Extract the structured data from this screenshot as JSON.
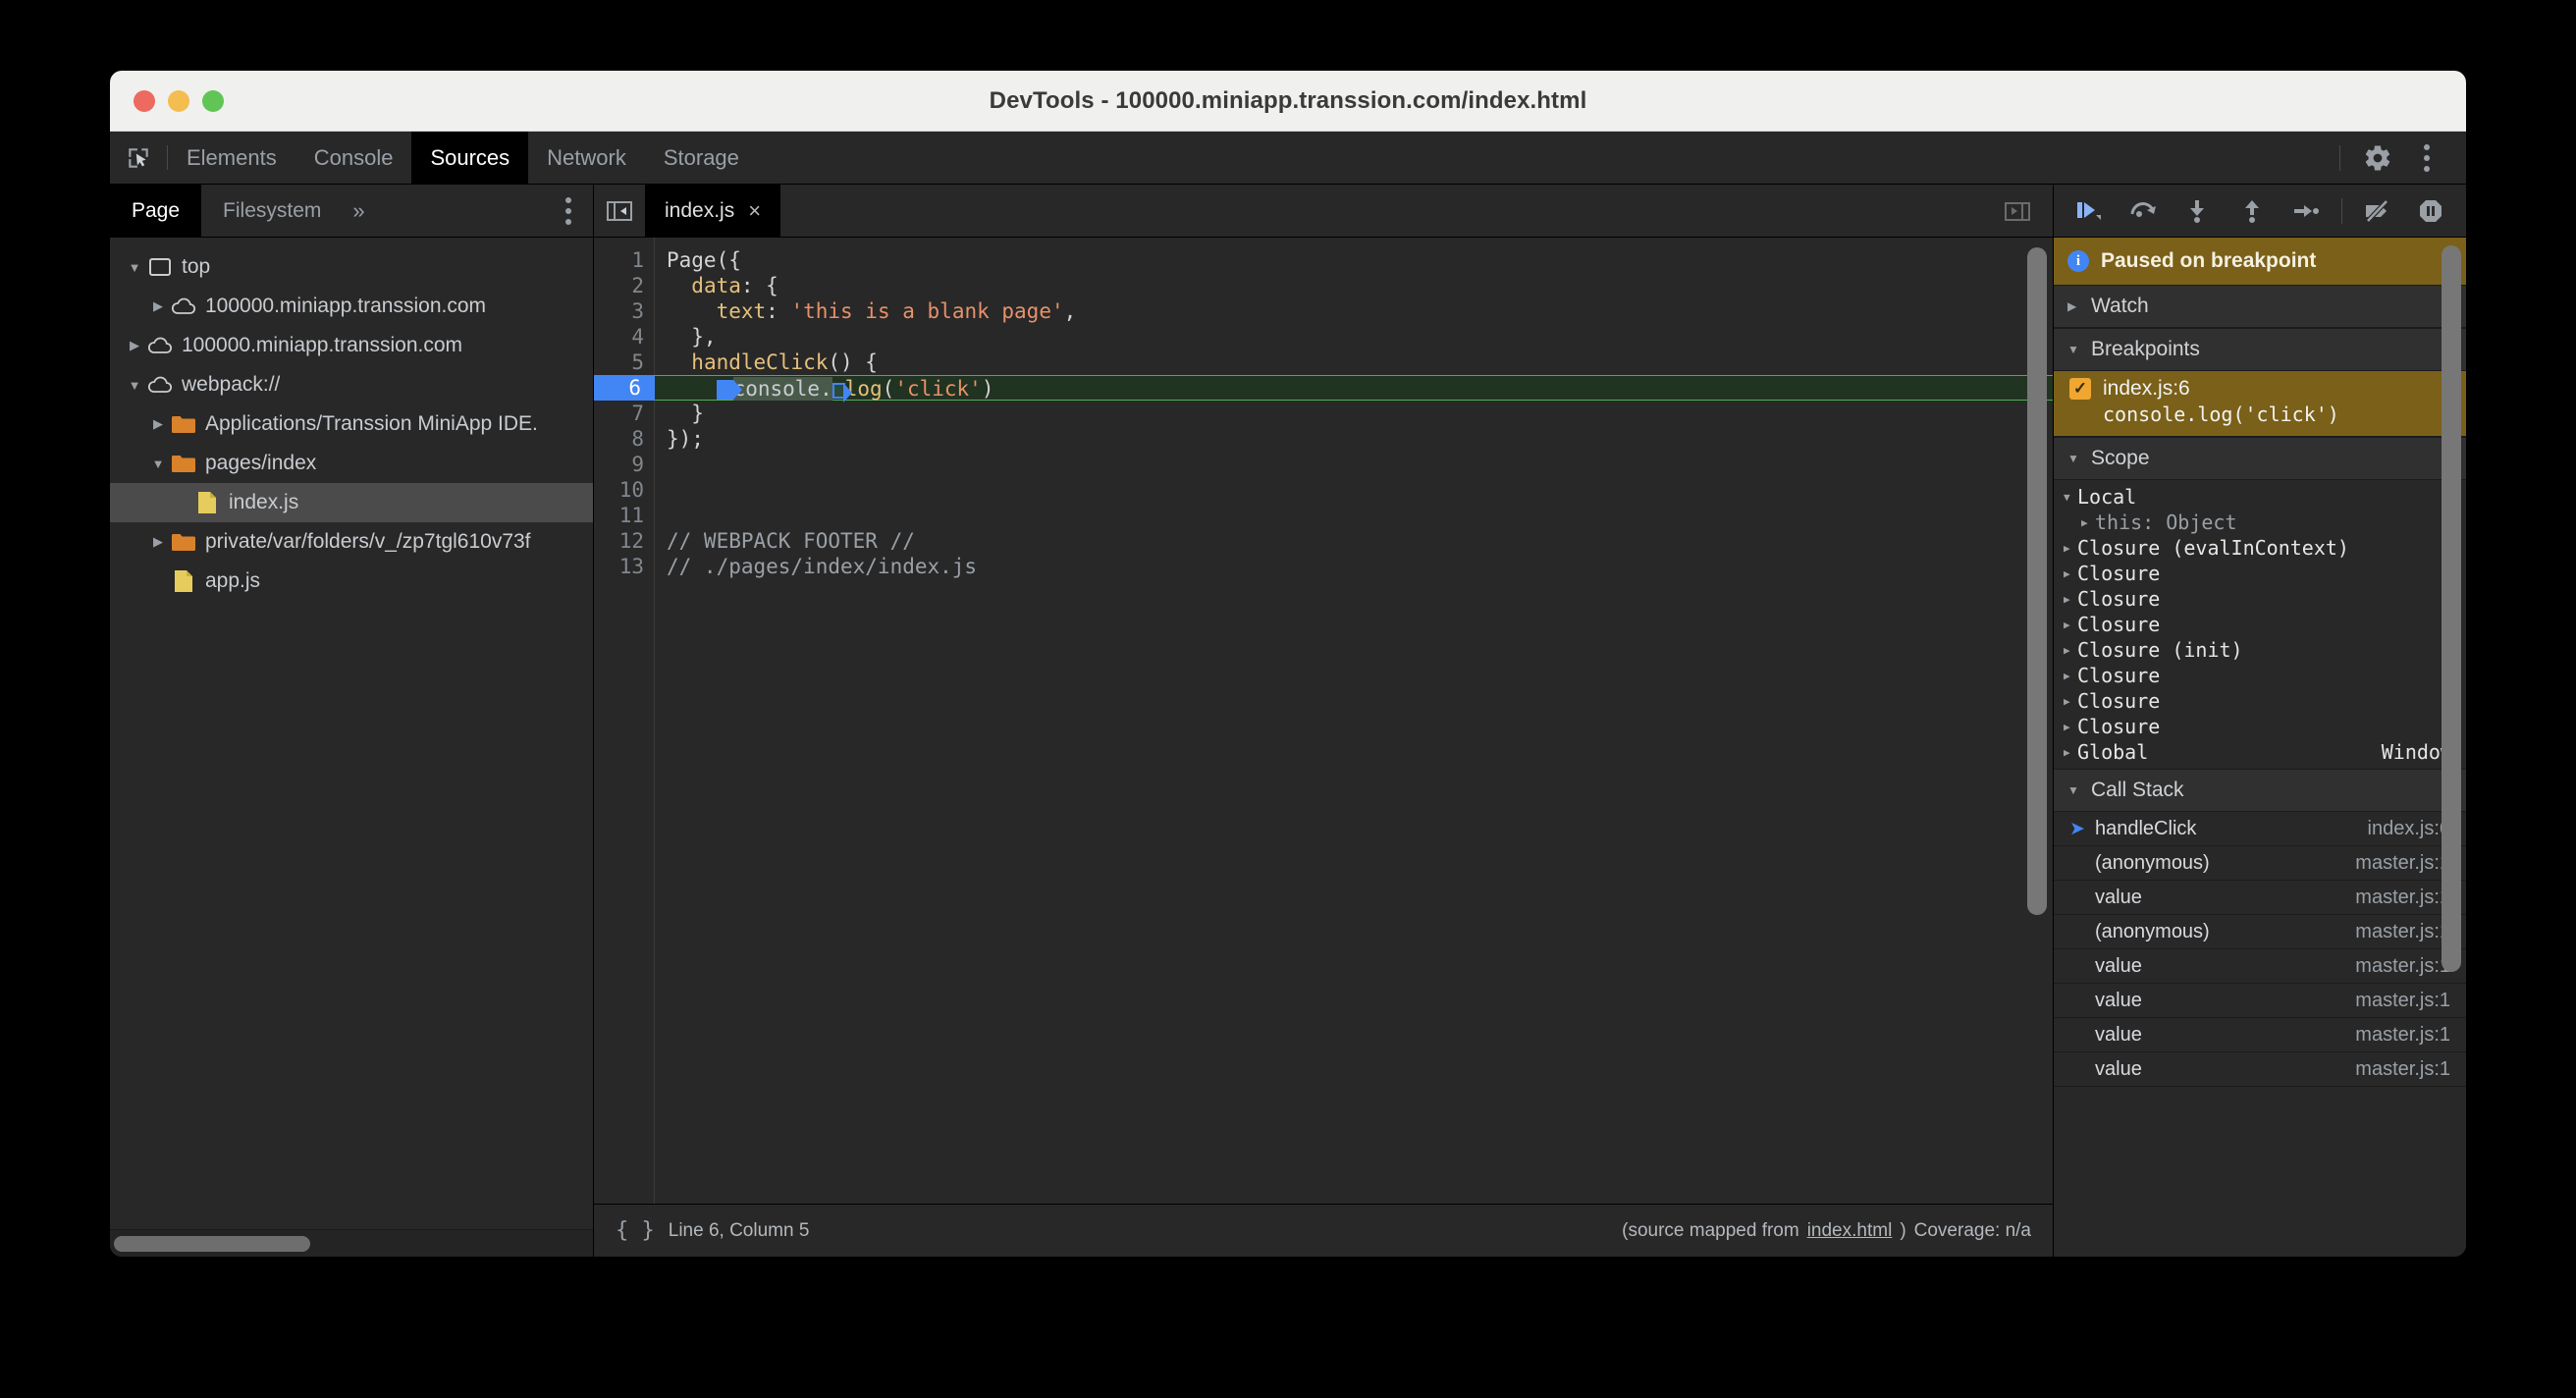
{
  "window": {
    "title": "DevTools - 100000.miniapp.transsion.com/index.html",
    "traffic_lights": [
      "close",
      "minimize",
      "zoom"
    ]
  },
  "devtools_tabs": {
    "inspect_icon": "inspect-cursor-icon",
    "items": [
      {
        "label": "Elements",
        "active": false
      },
      {
        "label": "Console",
        "active": false
      },
      {
        "label": "Sources",
        "active": true
      },
      {
        "label": "Network",
        "active": false
      },
      {
        "label": "Storage",
        "active": false
      }
    ],
    "settings_icon": "gear-icon",
    "menu_icon": "kebab-menu-icon"
  },
  "navigator": {
    "tabs": [
      {
        "label": "Page",
        "active": true
      },
      {
        "label": "Filesystem",
        "active": false
      }
    ],
    "overflow_label": "»",
    "menu_icon": "kebab-menu-icon",
    "tree": [
      {
        "label": "top",
        "icon": "frame-icon",
        "twisty": "▼",
        "depth": 0,
        "selected": false
      },
      {
        "label": "100000.miniapp.transsion.com",
        "icon": "cloud-icon",
        "twisty": "▶",
        "depth": 1,
        "selected": false
      },
      {
        "label": "100000.miniapp.transsion.com",
        "icon": "cloud-icon",
        "twisty": "▶",
        "depth": 0,
        "selected": false
      },
      {
        "label": "webpack://",
        "icon": "cloud-icon",
        "twisty": "▼",
        "depth": 0,
        "selected": false
      },
      {
        "label": "Applications/Transsion MiniApp IDE.",
        "icon": "folder-icon",
        "twisty": "▶",
        "depth": 1,
        "selected": false
      },
      {
        "label": "pages/index",
        "icon": "folder-icon",
        "twisty": "▼",
        "depth": 1,
        "selected": false
      },
      {
        "label": "index.js",
        "icon": "js-file-icon",
        "twisty": "",
        "depth": 2,
        "selected": true
      },
      {
        "label": "private/var/folders/v_/zp7tgl610v73f",
        "icon": "folder-icon",
        "twisty": "▶",
        "depth": 1,
        "selected": false
      },
      {
        "label": "app.js",
        "icon": "js-file-icon",
        "twisty": "",
        "depth": 1,
        "selected": false
      }
    ]
  },
  "editor": {
    "panel_toggle_icon": "show-navigator-icon",
    "right_toggle_icon": "show-debugger-icon",
    "tab": {
      "label": "index.js",
      "close_label": "×"
    },
    "line_numbers": [
      "1",
      "2",
      "3",
      "4",
      "5",
      "6",
      "7",
      "8",
      "9",
      "10",
      "11",
      "12",
      "13"
    ],
    "breakpoint_line": "6",
    "lines": [
      "Page({",
      "  data: {",
      "    text: 'this is a blank page',",
      "  },",
      "  handleClick() {",
      "    console.log('click')",
      "  }",
      "});",
      "",
      "",
      "",
      "// WEBPACK FOOTER //",
      "// ./pages/index/index.js"
    ]
  },
  "status_bar": {
    "braces_icon": "pretty-print-icon",
    "position": "Line 6, Column 5",
    "source_mapped_prefix": "(source mapped from ",
    "source_mapped_link": "index.html",
    "source_mapped_suffix": ")",
    "coverage": "Coverage: n/a"
  },
  "debugger": {
    "toolbar": [
      {
        "name": "resume-script-execution-icon",
        "accent": "#8ab4f8"
      },
      {
        "name": "step-over-icon",
        "accent": "#9aa0a6"
      },
      {
        "name": "step-into-icon",
        "accent": "#9aa0a6"
      },
      {
        "name": "step-out-icon",
        "accent": "#9aa0a6"
      },
      {
        "name": "step-icon",
        "accent": "#9aa0a6"
      },
      {
        "name": "deactivate-breakpoints-icon",
        "accent": "#9aa0a6"
      },
      {
        "name": "pause-on-exceptions-icon",
        "accent": "#9aa0a6"
      }
    ],
    "paused_banner": {
      "text": "Paused on breakpoint",
      "icon": "info-icon",
      "bg": "#7a6018"
    },
    "watch": {
      "label": "Watch",
      "caret": "▶"
    },
    "breakpoints": {
      "label": "Breakpoints",
      "caret": "▼",
      "items": [
        {
          "location": "index.js:6",
          "snippet": "console.log('click')",
          "checked": true
        }
      ]
    },
    "scope": {
      "label": "Scope",
      "caret": "▼",
      "rows": [
        {
          "caret": "▼",
          "label": "Local",
          "value": "",
          "indent": false,
          "dim": false
        },
        {
          "caret": "▶",
          "label": "this: Object",
          "value": "",
          "indent": true,
          "dim": true
        },
        {
          "caret": "▶",
          "label": "Closure (evalInContext)",
          "value": "",
          "indent": false,
          "dim": false
        },
        {
          "caret": "▶",
          "label": "Closure",
          "value": "",
          "indent": false,
          "dim": false
        },
        {
          "caret": "▶",
          "label": "Closure",
          "value": "",
          "indent": false,
          "dim": false
        },
        {
          "caret": "▶",
          "label": "Closure",
          "value": "",
          "indent": false,
          "dim": false
        },
        {
          "caret": "▶",
          "label": "Closure (init)",
          "value": "",
          "indent": false,
          "dim": false
        },
        {
          "caret": "▶",
          "label": "Closure",
          "value": "",
          "indent": false,
          "dim": false
        },
        {
          "caret": "▶",
          "label": "Closure",
          "value": "",
          "indent": false,
          "dim": false
        },
        {
          "caret": "▶",
          "label": "Closure",
          "value": "",
          "indent": false,
          "dim": false
        },
        {
          "caret": "▶",
          "label": "Global",
          "value": "Window",
          "indent": false,
          "dim": false
        }
      ]
    },
    "call_stack": {
      "label": "Call Stack",
      "caret": "▼",
      "frames": [
        {
          "fn": "handleClick",
          "loc": "index.js:6",
          "current": true
        },
        {
          "fn": "(anonymous)",
          "loc": "master.js:1",
          "current": false
        },
        {
          "fn": "value",
          "loc": "master.js:1",
          "current": false
        },
        {
          "fn": "(anonymous)",
          "loc": "master.js:1",
          "current": false
        },
        {
          "fn": "value",
          "loc": "master.js:1",
          "current": false
        },
        {
          "fn": "value",
          "loc": "master.js:1",
          "current": false
        },
        {
          "fn": "value",
          "loc": "master.js:1",
          "current": false
        },
        {
          "fn": "value",
          "loc": "master.js:1",
          "current": false
        }
      ]
    }
  },
  "colors": {
    "accent_blue": "#4285f4",
    "breakpoint_amber": "#7a6018",
    "exec_line_green": "#213321",
    "exec_line_border": "#4caf50",
    "panel_bg": "#282828",
    "titlebar_bg": "#f0f0ef"
  }
}
